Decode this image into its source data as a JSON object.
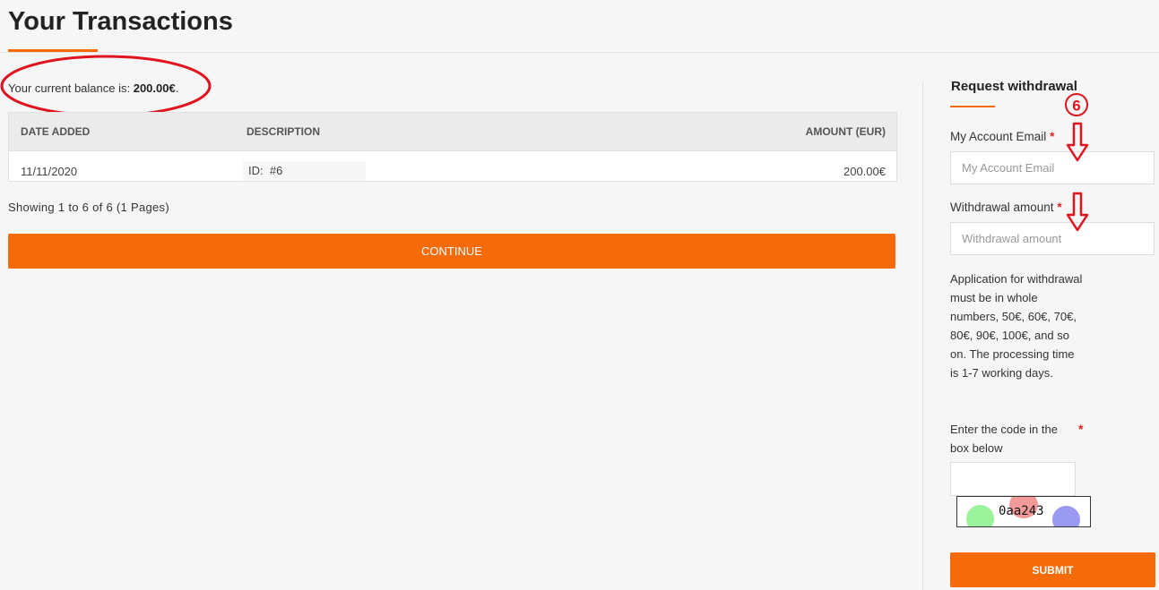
{
  "page": {
    "title": "Your Transactions"
  },
  "balance": {
    "prefix": "Your current balance is: ",
    "amount": "200.00€",
    "suffix": "."
  },
  "table": {
    "columns": [
      "DATE ADDED",
      "DESCRIPTION",
      "AMOUNT (EUR)"
    ],
    "rows": [
      {
        "date": "11/11/2020",
        "description": "ID:  #6",
        "amount": "200.00€"
      }
    ]
  },
  "pagination": {
    "text": "Showing 1 to 6 of 6 (1 Pages)"
  },
  "buttons": {
    "continue": "CONTINUE",
    "submit": "SUBMIT"
  },
  "withdrawal": {
    "title": "Request withdrawal",
    "email": {
      "label": "My Account Email",
      "required_mark": "*",
      "placeholder": "My Account Email"
    },
    "amount": {
      "label": "Withdrawal amount",
      "required_mark": "*",
      "placeholder": "Withdrawal amount"
    },
    "info": "Application for withdrawal must be in whole numbers, 50€, 60€, 70€, 80€, 90€, 100€, and so on. The processing time is 1-7 working days.",
    "captcha": {
      "label": "Enter the code in the box below",
      "required_mark": "*",
      "code": "0aa243"
    }
  },
  "annotation": {
    "step_number": "6"
  },
  "colors": {
    "accent": "#f56b0a",
    "annotation_red": "#e0141e",
    "required": "#e02020"
  }
}
